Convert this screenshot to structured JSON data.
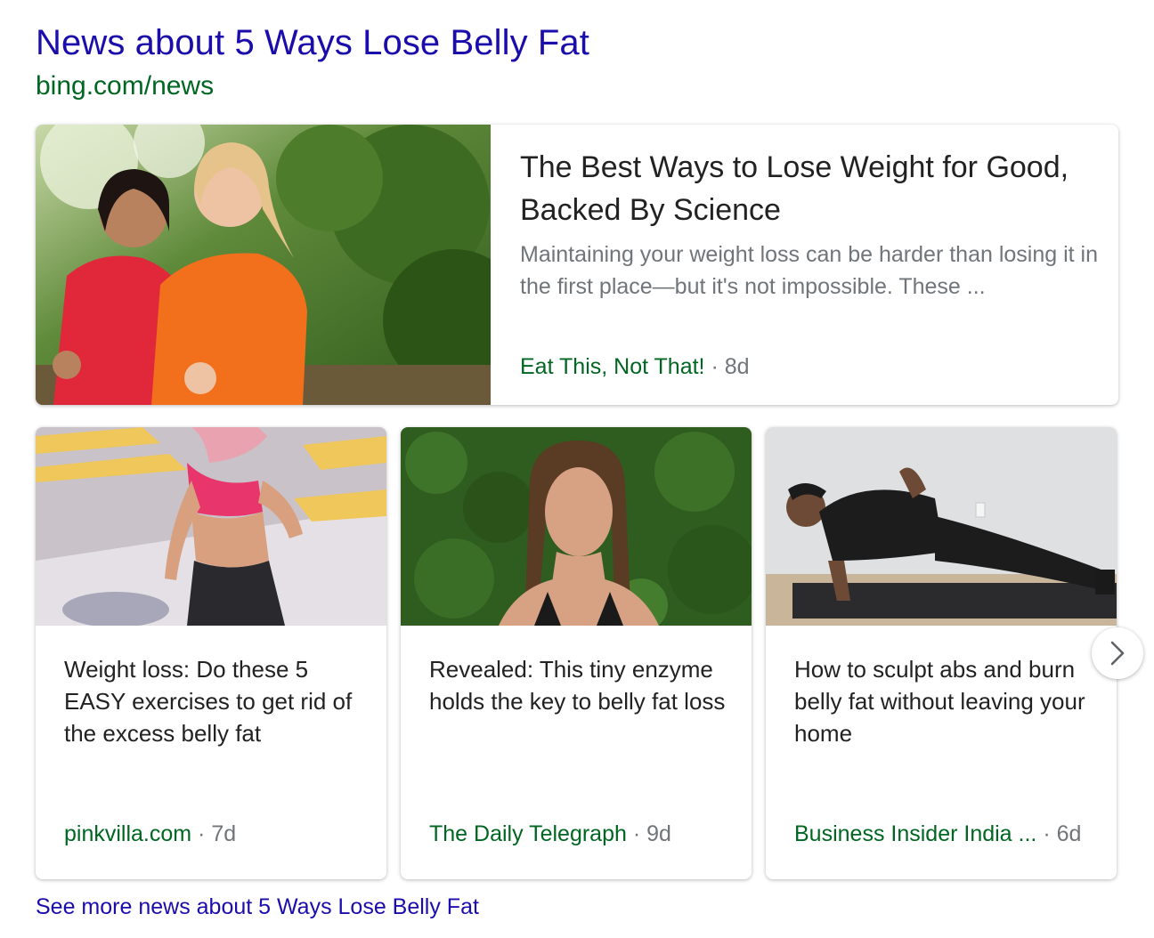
{
  "header": {
    "title": "News about 5 Ways Lose Belly Fat",
    "url": "bing.com/news"
  },
  "featured": {
    "title": "The Best Ways to Lose Weight for Good, Backed By Science",
    "snippet": "Maintaining your weight loss can be harder than losing it in the first place—but it's not impossible. These ...",
    "source": "Eat This, Not That!",
    "separator": " · ",
    "age": "8d"
  },
  "cards": [
    {
      "title": "Weight loss: Do these 5 EASY exercises to get rid of the excess belly fat",
      "source": "pinkvilla.com",
      "separator": " · ",
      "age": "7d"
    },
    {
      "title": "Revealed: This tiny enzyme holds the key to belly fat loss",
      "source": "The Daily Telegraph",
      "separator": " · ",
      "age": "9d"
    },
    {
      "title": "How to sculpt abs and burn belly fat without leaving your home",
      "source": "Business Insider India ...",
      "separator": " · ",
      "age": "6d"
    }
  ],
  "navigation": {
    "next_icon": "chevron-right-icon"
  },
  "footer": {
    "see_more": "See more news about 5 Ways Lose Belly Fat"
  },
  "colors": {
    "link": "#1a0dab",
    "url_green": "#006621",
    "title_text": "#222222",
    "meta_gray": "#70757a"
  }
}
